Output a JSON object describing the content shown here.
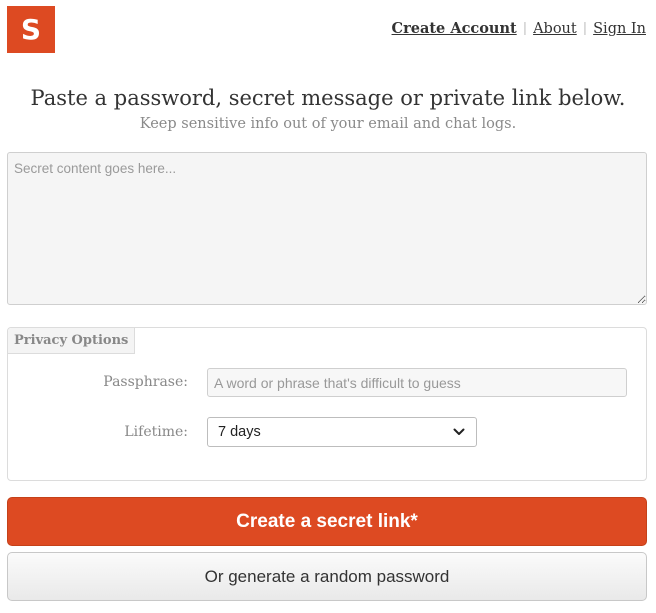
{
  "logo": {
    "letter": "S"
  },
  "nav": {
    "create_account": "Create Account",
    "about": "About",
    "sign_in": "Sign In",
    "separator": "|"
  },
  "hero": {
    "headline": "Paste a password, secret message or private link below.",
    "tagline": "Keep sensitive info out of your email and chat logs."
  },
  "secret": {
    "placeholder": "Secret content goes here...",
    "value": ""
  },
  "privacy": {
    "tab_label": "Privacy Options",
    "passphrase_label": "Passphrase:",
    "passphrase_placeholder": "A word or phrase that's difficult to guess",
    "lifetime_label": "Lifetime:",
    "lifetime_selected": "7 days"
  },
  "actions": {
    "create_label": "Create a secret link*",
    "generate_label": "Or generate a random password"
  },
  "colors": {
    "brand": "#dd4a22",
    "muted_text": "#888888"
  }
}
